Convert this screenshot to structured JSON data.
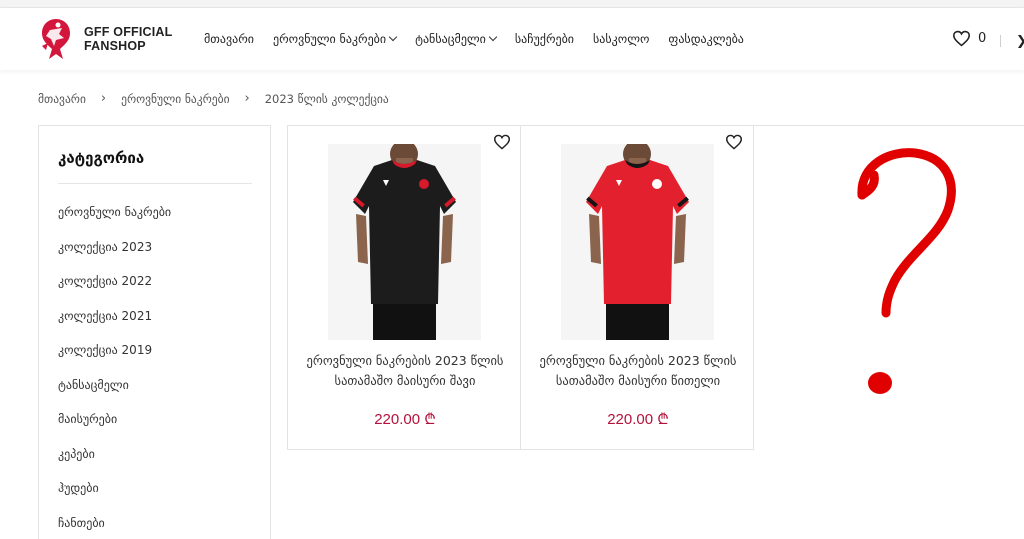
{
  "brand": {
    "line1": "GFF OFFICIAL",
    "line2": "FANSHOP"
  },
  "nav": [
    {
      "label": "მთავარი",
      "dropdown": false
    },
    {
      "label": "ეროვნული ნაკრები",
      "dropdown": true
    },
    {
      "label": "ტანსაცმელი",
      "dropdown": true
    },
    {
      "label": "საჩუქრები",
      "dropdown": false
    },
    {
      "label": "სასკოლო",
      "dropdown": false
    },
    {
      "label": "ფასდაკლება",
      "dropdown": false
    }
  ],
  "wishlist": {
    "count": "0"
  },
  "breadcrumb": {
    "home": "მთავარი",
    "section": "ეროვნული ნაკრები",
    "current": "2023 წლის კოლექცია"
  },
  "sidebar": {
    "title": "კატეგორია",
    "items": [
      "ეროვნული ნაკრები",
      "კოლექცია 2023",
      "კოლექცია 2022",
      "კოლექცია 2021",
      "კოლექცია 2019",
      "ტანსაცმელი",
      "მაისურები",
      "კეპები",
      "ჰუდები",
      "ჩანთები"
    ]
  },
  "products": [
    {
      "name": "ეროვნული ნაკრების 2023 წლის სათამაშო მაისური შავი",
      "price": "220.00 ₾",
      "shirt_color": "#1c1c1c",
      "trim_color": "#d61a2b"
    },
    {
      "name": "ეროვნული ნაკრების 2023 წლის სათამაშო მაისური წითელი",
      "price": "220.00 ₾",
      "shirt_color": "#e3202e",
      "trim_color": "#151515"
    }
  ],
  "colors": {
    "accent_price": "#b5123b",
    "logo_red": "#d3163c",
    "question_mark": "#e00000"
  }
}
